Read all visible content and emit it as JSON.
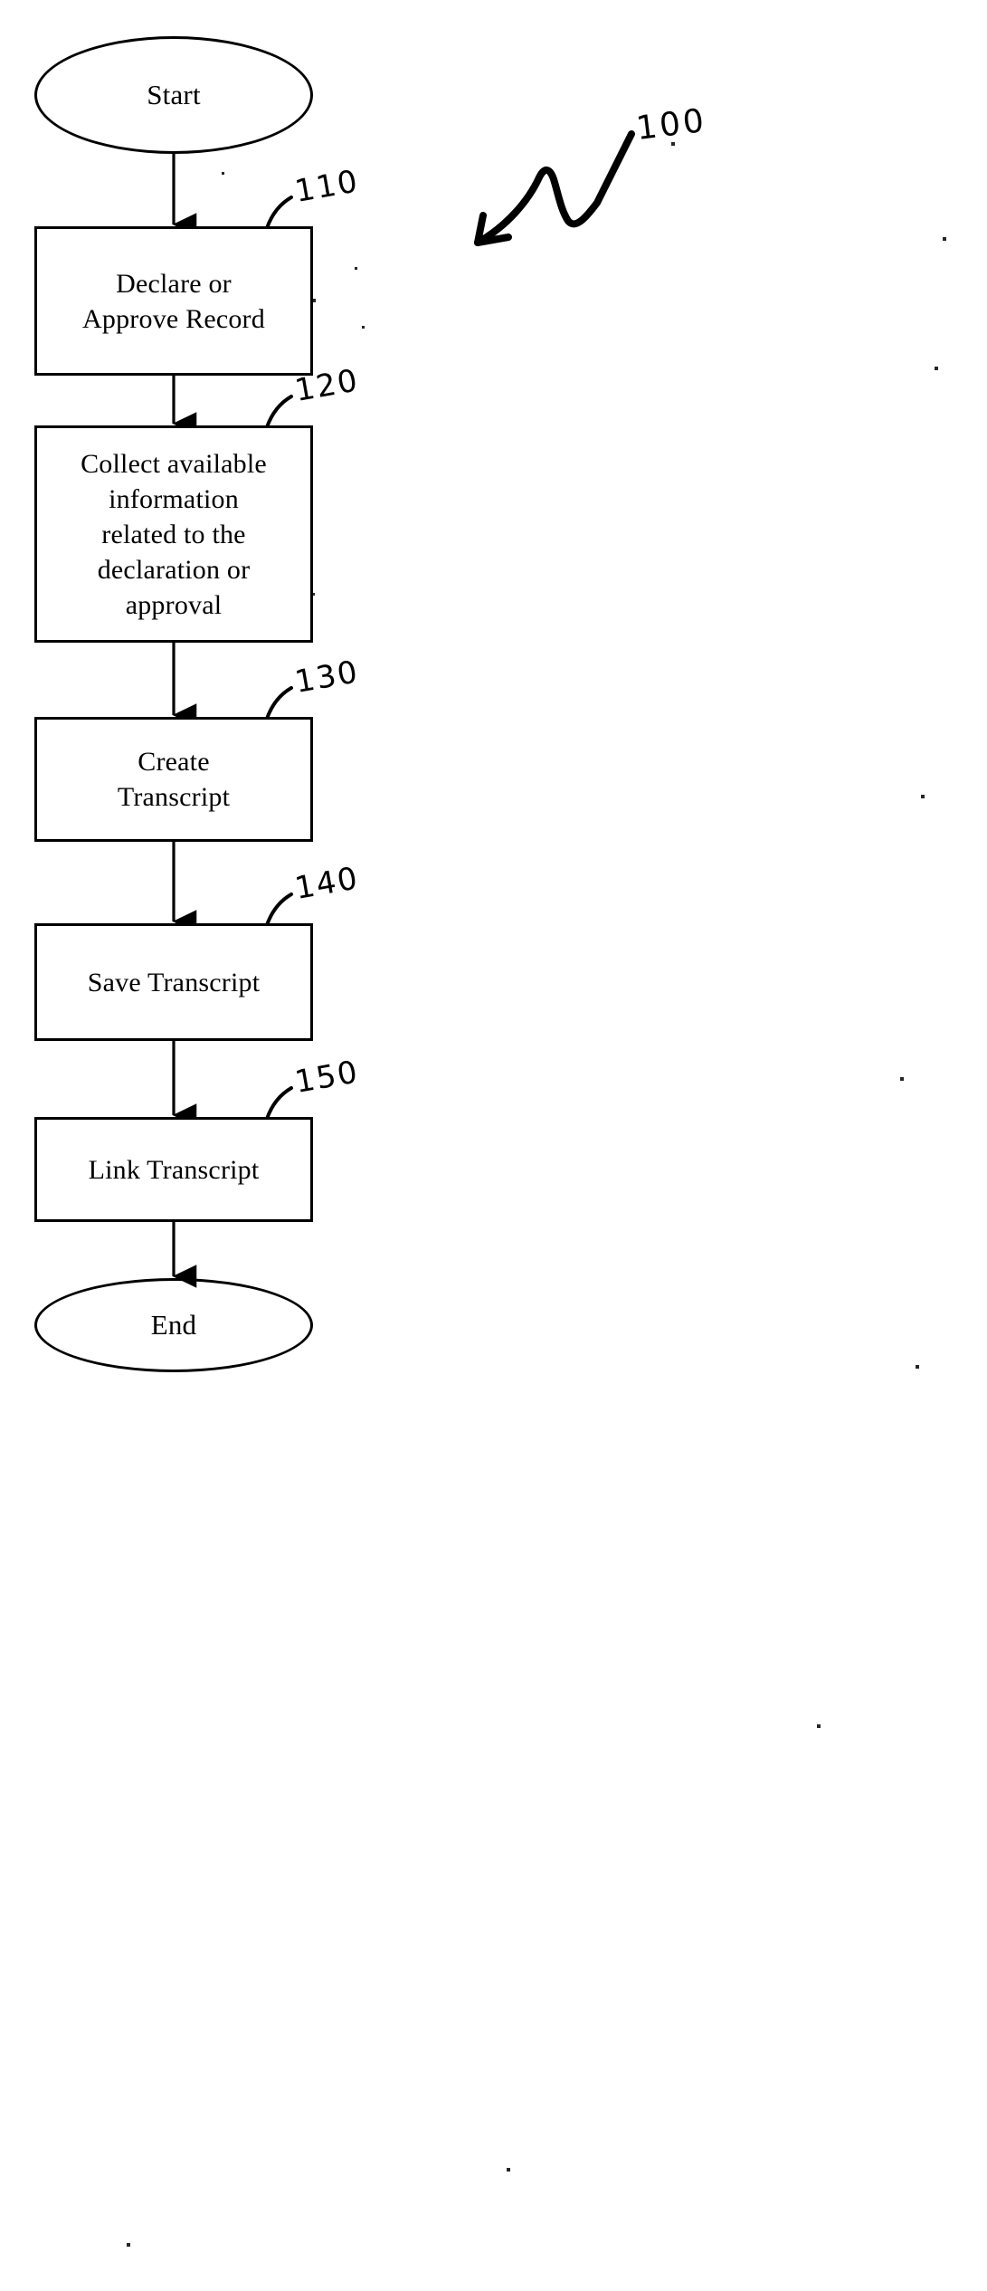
{
  "figure": {
    "type": "flowchart",
    "title": "",
    "main_reference": "100",
    "nodes": [
      {
        "id": "start",
        "shape": "ellipse",
        "label": "Start",
        "ref": ""
      },
      {
        "id": "n110",
        "shape": "rect",
        "label": "Declare or\nApprove Record",
        "ref": "110"
      },
      {
        "id": "n120",
        "shape": "rect",
        "label": "Collect available\ninformation\nrelated to the\ndeclaration or\napproval",
        "ref": "120"
      },
      {
        "id": "n130",
        "shape": "rect",
        "label": "Create\nTranscript",
        "ref": "130"
      },
      {
        "id": "n140",
        "shape": "rect",
        "label": "Save Transcript",
        "ref": "140"
      },
      {
        "id": "n150",
        "shape": "rect",
        "label": "Link Transcript",
        "ref": "150"
      },
      {
        "id": "end",
        "shape": "ellipse",
        "label": "End",
        "ref": ""
      }
    ],
    "edges": [
      {
        "from": "start",
        "to": "n110"
      },
      {
        "from": "n110",
        "to": "n120"
      },
      {
        "from": "n120",
        "to": "n130"
      },
      {
        "from": "n130",
        "to": "n140"
      },
      {
        "from": "n140",
        "to": "n150"
      },
      {
        "from": "n150",
        "to": "end"
      }
    ],
    "colors": {
      "stroke": "#000000",
      "fill": "#ffffff",
      "text": "#000000"
    }
  }
}
